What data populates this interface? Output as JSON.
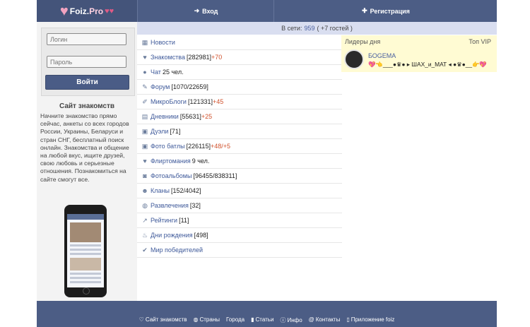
{
  "header": {
    "logo_text": "Foiz.",
    "logo_domain": "Pro",
    "login_label": "Вход",
    "register_label": "Регистрация"
  },
  "login_form": {
    "login_placeholder": "Логин",
    "password_placeholder": "Пароль",
    "submit_label": "Войти"
  },
  "about": {
    "title": "Сайт знакомств",
    "text": "Начните знакомство прямо сейчас, анкеты со всех городов России, Украины, Беларуси и стран СНГ, бесплатный поиск онлайн. Знакомства и общение на любой вкус, ищите друзей, свою любовь и серьезные отношения. Познакомиться на сайте смогут все."
  },
  "online": {
    "label": "В сети:",
    "count": "959",
    "guests": "( +7 гостей )"
  },
  "menu": [
    {
      "icon": "rss-icon",
      "glyph": "▦",
      "label": "Новости",
      "count": "",
      "plus": ""
    },
    {
      "icon": "heart-icon",
      "glyph": "♥",
      "label": "Знакомства",
      "count": "[282981]",
      "plus": "+70"
    },
    {
      "icon": "chat-icon",
      "glyph": "●",
      "label": "Чат",
      "count": "25 чел.",
      "plus": ""
    },
    {
      "icon": "pencil-icon",
      "glyph": "✎",
      "label": "Форум",
      "count": "[1070/22659]",
      "plus": ""
    },
    {
      "icon": "edit-icon",
      "glyph": "✐",
      "label": "МикроБлоги",
      "count": "[121331]",
      "plus": "+45"
    },
    {
      "icon": "book-icon",
      "glyph": "▤",
      "label": "Дневники",
      "count": "[55631]",
      "plus": "+25"
    },
    {
      "icon": "duel-icon",
      "glyph": "▣",
      "label": "Дуэли",
      "count": "[71]",
      "plus": ""
    },
    {
      "icon": "photo-battle-icon",
      "glyph": "▣",
      "label": "Фото батлы",
      "count": "[226115]",
      "plus": "+48/+5"
    },
    {
      "icon": "heartbeat-icon",
      "glyph": "♥",
      "label": "Флиртомания",
      "count": "9 чел.",
      "plus": ""
    },
    {
      "icon": "camera-icon",
      "glyph": "◙",
      "label": "Фотоальбомы",
      "count": "[96455/838311]",
      "plus": ""
    },
    {
      "icon": "users-icon",
      "glyph": "☻",
      "label": "Кланы",
      "count": "[152/4042]",
      "plus": ""
    },
    {
      "icon": "gamepad-icon",
      "glyph": "◍",
      "label": "Развлечения",
      "count": "[32]",
      "plus": ""
    },
    {
      "icon": "chart-icon",
      "glyph": "↗",
      "label": "Рейтинги",
      "count": "[11]",
      "plus": ""
    },
    {
      "icon": "birthday-icon",
      "glyph": "♨",
      "label": "Дни рождения",
      "count": "[498]",
      "plus": ""
    },
    {
      "icon": "winners-icon",
      "glyph": "✔",
      "label": "Мир победителей",
      "count": "",
      "plus": ""
    }
  ],
  "leaders": {
    "title": "Лидеры дня",
    "top_vip": "Топ VIP",
    "user_name": "БОGЕМА",
    "user_status": "💖👈___●♛● ▸ ШАХ_и_МАТ ◂ ●♛●__👉💖"
  },
  "footer": [
    {
      "icon": "heart-outline-icon",
      "glyph": "♡",
      "label": "Сайт знакомств"
    },
    {
      "icon": "globe-icon",
      "glyph": "◍",
      "label": "Страны"
    },
    {
      "icon": "",
      "glyph": "",
      "label": "Города"
    },
    {
      "icon": "bookmark-icon",
      "glyph": "▮",
      "label": "Статьи"
    },
    {
      "icon": "info-icon",
      "glyph": "ⓘ",
      "label": "Инфо"
    },
    {
      "icon": "at-icon",
      "glyph": "@",
      "label": "Контакты"
    },
    {
      "icon": "phone-icon",
      "glyph": "▯",
      "label": "Приложение foiz"
    }
  ]
}
